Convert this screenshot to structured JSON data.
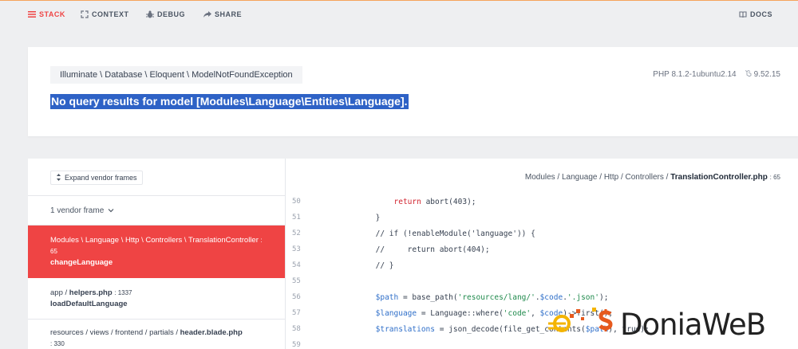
{
  "nav": {
    "stack": "STACK",
    "context": "CONTEXT",
    "debug": "DEBUG",
    "share": "SHARE",
    "docs": "DOCS"
  },
  "exception": {
    "class": "Illuminate \\ Database \\ Eloquent \\ ModelNotFoundException",
    "message": "No query results for model [Modules\\Language\\Entities\\Language].",
    "php_version": "PHP 8.1.2-1ubuntu2.14",
    "laravel_version": "9.52.15"
  },
  "frames_panel": {
    "expand_label": "Expand vendor frames",
    "vendor_count": "1 vendor frame",
    "frames": [
      {
        "path": "Modules \\ Language \\ Http \\ Controllers \\ TranslationController",
        "line": ": 65",
        "method": "changeLanguage"
      },
      {
        "path_prefix": "app / ",
        "path_file": "helpers.php",
        "line": ": 1337",
        "method": "loadDefaultLanguage"
      },
      {
        "path_prefix": "resources / views / frontend / partials / ",
        "path_file": "header.blade.php",
        "line": ": 330"
      }
    ]
  },
  "code": {
    "file_prefix": "Modules / Language / Http / Controllers / ",
    "file_name": "TranslationController.php",
    "file_line": ": 65",
    "line_numbers": [
      "50",
      "51",
      "52",
      "53",
      "54",
      "55",
      "56",
      "57",
      "58",
      "59"
    ]
  },
  "watermark": {
    "brand": "DoniaWeB",
    "colors": {
      "gold": "#f4b400",
      "orange": "#e65a1e",
      "blue": "#1e88e5"
    }
  },
  "colors": {
    "accent": "#ef4444",
    "selection": "#2e62c6"
  }
}
